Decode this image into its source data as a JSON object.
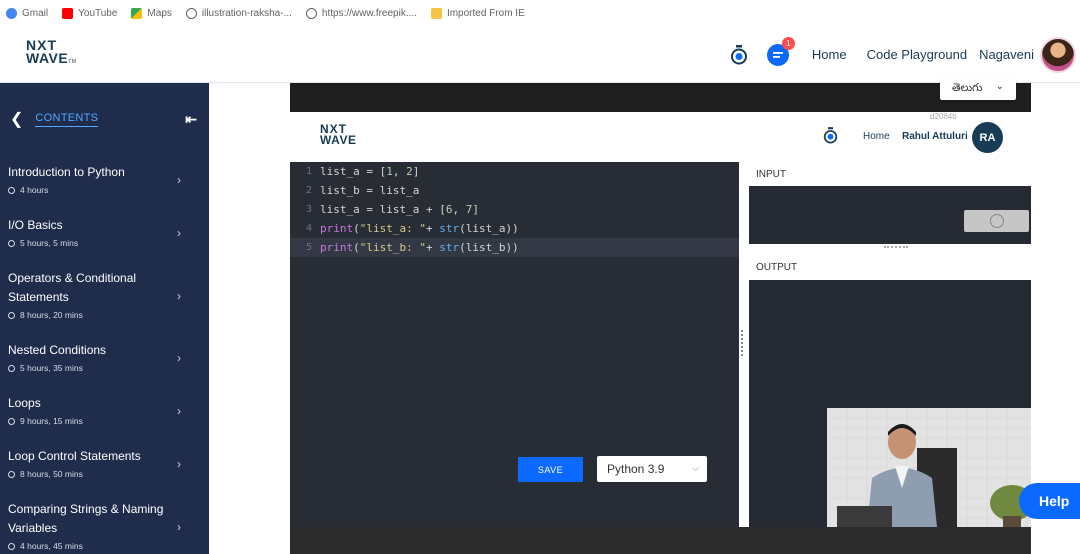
{
  "bookmarks": [
    {
      "label": "Gmail",
      "color": "#ea4335"
    },
    {
      "label": "YouTube",
      "color": "#ff0000"
    },
    {
      "label": "Maps",
      "color": "#34a853"
    },
    {
      "label": "illustration-raksha-...",
      "color": "#5f6368"
    },
    {
      "label": "https://www.freepik....",
      "color": "#5f6368"
    },
    {
      "label": "Imported From IE",
      "color": "#f6c343"
    }
  ],
  "header": {
    "logo_line1": "NXT",
    "logo_line2": "WAVE",
    "logo_tm": "TM",
    "notification_count": "1",
    "nav": [
      "Home",
      "Code Playground"
    ],
    "user_name": "Nagaveni"
  },
  "sidebar": {
    "heading": "CONTENTS",
    "items": [
      {
        "title": "Introduction to Python",
        "duration": "4 hours"
      },
      {
        "title": "I/O Basics",
        "duration": "5 hours, 5 mins"
      },
      {
        "title": "Operators & Conditional Statements",
        "duration": "8 hours, 20 mins"
      },
      {
        "title": "Nested Conditions",
        "duration": "5 hours, 35 mins"
      },
      {
        "title": "Loops",
        "duration": "9 hours, 15 mins"
      },
      {
        "title": "Loop Control Statements",
        "duration": "8 hours, 50 mins"
      },
      {
        "title": "Comparing Strings & Naming Variables",
        "duration": "4 hours, 45 mins"
      }
    ]
  },
  "video": {
    "language": "తెలుగు",
    "id_text": "d2064b",
    "inner_logo_line1": "NXT",
    "inner_logo_line2": "WAVE",
    "inner_nav_home": "Home",
    "inner_user_name": "Rahul Attuluri",
    "inner_avatar_initials": "RA",
    "code_lines": [
      "list_a = [1, 2]",
      "list_b = list_a",
      "list_a = list_a + [6, 7]",
      "print(\"list_a: \"+ str(list_a))",
      "print(\"list_b: \"+ str(list_b))"
    ],
    "active_line": 5,
    "save_label": "SAVE",
    "python_version": "Python 3.9",
    "input_label": "INPUT",
    "output_label": "OUTPUT"
  },
  "help_label": "Help",
  "colors": {
    "sidebar_bg": "#1f2c4c",
    "accent_blue": "#0b69ff",
    "contents_blue": "#53a7ff",
    "editor_bg": "#272c35"
  }
}
